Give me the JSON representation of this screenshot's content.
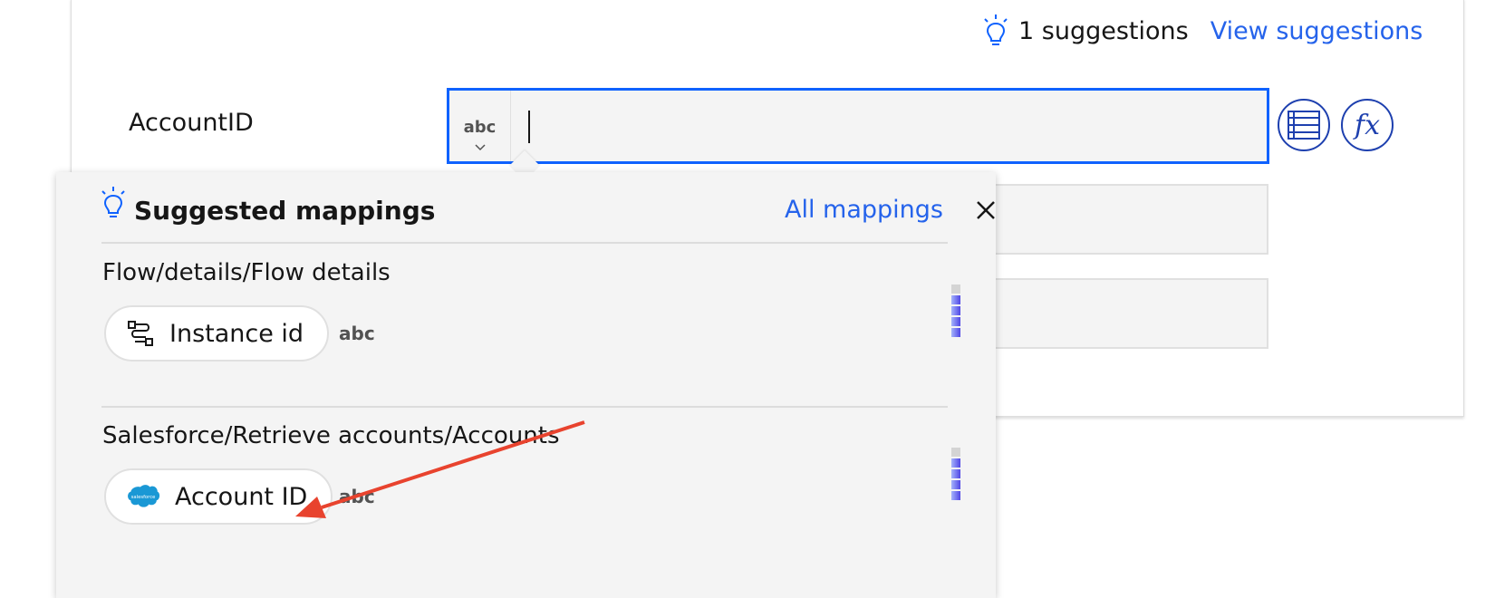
{
  "suggestions": {
    "count_text": "1 suggestions",
    "view_link": "View suggestions",
    "icon": "lightbulb-icon"
  },
  "field": {
    "label": "AccountID",
    "type": "abc",
    "value": ""
  },
  "side_buttons": {
    "list_icon": "list-icon",
    "fx_label": "fx"
  },
  "popover": {
    "title": "Suggested mappings",
    "all_link": "All mappings",
    "close_icon": "close-icon",
    "groups": [
      {
        "title": "Flow/details/Flow details",
        "item": {
          "label": "Instance id",
          "type": "abc",
          "icon": "flow-path-icon"
        }
      },
      {
        "title": "Salesforce/Retrieve accounts/Accounts",
        "item": {
          "label": "Account ID",
          "type": "abc",
          "icon": "salesforce-logo-icon",
          "logo_text": "salesforce"
        }
      }
    ]
  },
  "colors": {
    "link": "#2563eb",
    "focus_border": "#0f62fe",
    "annotation_arrow": "#e8432e"
  }
}
